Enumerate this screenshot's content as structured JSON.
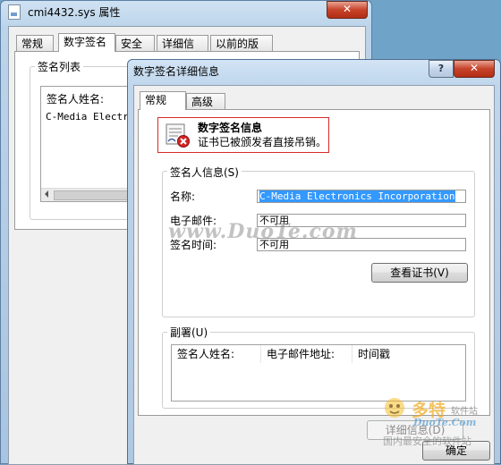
{
  "back_window": {
    "title": "cmi4432.sys 属性",
    "close_glyph": "✕",
    "tabs": [
      "常规",
      "数字签名",
      "安全",
      "详细信息",
      "以前的版本"
    ],
    "group_label": "签名列表",
    "list_header": "签名人姓名:",
    "list_row": "C-Media Electro"
  },
  "dialog": {
    "title": "数字签名详细信息",
    "help_glyph": "?",
    "close_glyph": "✕",
    "tabs": [
      "常规",
      "高级"
    ],
    "info_title": "数字签名信息",
    "info_text": "证书已被颁发者直接吊销。",
    "signer_group": "签名人信息(S)",
    "name_label": "名称:",
    "name_value": "C-Media Electronics Incorporation",
    "email_label": "电子邮件:",
    "email_value": "不可用",
    "time_label": "签名时间:",
    "time_value": "不可用",
    "view_cert_button": "查看证书(V)",
    "countersig_group": "副署(U)",
    "col_signer": "签名人姓名:",
    "col_email": "电子邮件地址:",
    "col_timestamp": "时间戳",
    "details_button": "详细信息(D)",
    "ok_button": "确定"
  },
  "watermarks": {
    "center": "www.DuoTe.com",
    "brand": "多特",
    "brand_sub": "软件站",
    "brand_url": "DuoTe.Com",
    "footer": "国内最安全的软件站"
  },
  "colors": {
    "highlight_border": "#d92a2a",
    "selection": "#3399ff",
    "accent_titlebar": "#bfd6ec"
  }
}
